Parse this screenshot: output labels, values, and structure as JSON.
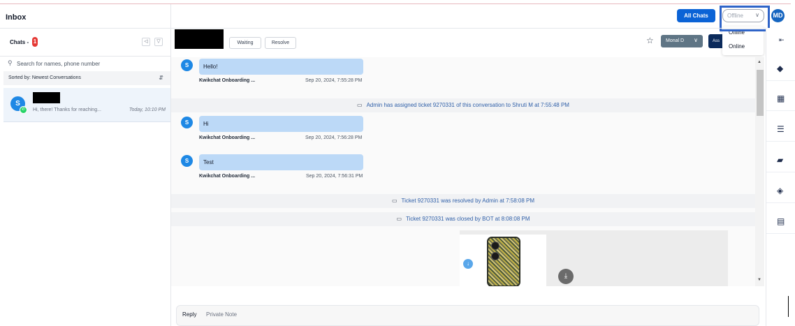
{
  "inbox": {
    "title": "Inbox",
    "chats_label": "Chats -",
    "unread_count": "1",
    "search": {
      "placeholder": "Search for names, phone number"
    },
    "sort_label": "Sorted by: Newest Conversations",
    "conversations": [
      {
        "avatar_letter": "S",
        "preview": "Hi, there! Thanks for reaching...",
        "time": "Today, 10:10 PM"
      }
    ]
  },
  "header": {
    "all_chats_label": "All Chats",
    "status_value": "Offline",
    "status_options": [
      "Offline",
      "Online"
    ],
    "user_initials": "MD"
  },
  "conversation": {
    "waiting_label": "Waiting",
    "resolve_label": "Resolve",
    "agent_name": "Monal D",
    "assign_label": "Ass",
    "messages": [
      {
        "avatar": "S",
        "text": "Hello!",
        "sender": "Kwikchat Onboarding ...",
        "time": "Sep 20, 2024, 7:55:28 PM"
      },
      {
        "avatar": "S",
        "text": "Hi",
        "sender": "Kwikchat Onboarding ...",
        "time": "Sep 20, 2024, 7:56:28 PM"
      },
      {
        "avatar": "S",
        "text": "Test",
        "sender": "Kwikchat Onboarding ...",
        "time": "Sep 20, 2024, 7:56:31 PM"
      }
    ],
    "system_events": [
      "Admin has assigned ticket 9270331 of this conversation to Shruti M at 7:55:48 PM",
      "Ticket 9270331 was resolved by Admin at 7:58:08 PM",
      "Ticket 9270331 was closed by BOT at 8:08:08 PM"
    ]
  },
  "composer": {
    "tabs": [
      "Reply",
      "Private Note"
    ]
  },
  "colors": {
    "primary": "#0b63d6",
    "bubble": "#bcd9f7",
    "system_text": "#2f5fa8",
    "highlight_box": "#2f64c8",
    "badge": "#e53935",
    "whatsapp": "#25d366"
  },
  "icons": {
    "rail": [
      "collapse-icon",
      "tag-icon",
      "calendar-icon",
      "list-icon",
      "bag-icon",
      "tags-icon",
      "document-icon"
    ]
  }
}
